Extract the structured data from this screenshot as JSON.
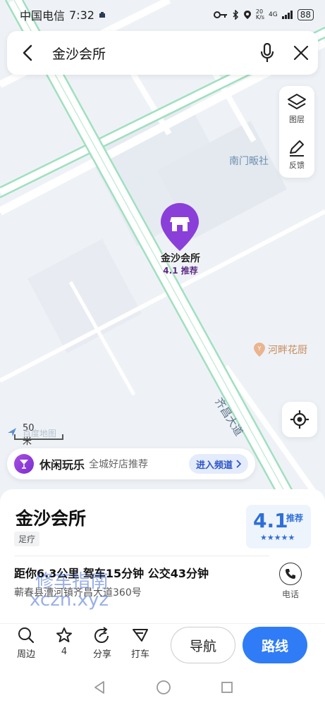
{
  "status_bar": {
    "carrier": "中国电信",
    "time": "7:32",
    "net_speed_top": "20",
    "net_speed_bottom": "K/s",
    "signal": "4G",
    "battery": "88"
  },
  "search": {
    "query": "金沙会所"
  },
  "map_tools": {
    "layers_label": "图层",
    "feedback_label": "反馈"
  },
  "map": {
    "poi_name": "金沙会所",
    "poi_rating": "4.1 推荐",
    "label_nanmen": "南门畈社",
    "label_hepan": "河畔花厨",
    "road_name": "齐昌大道",
    "scale": "50米",
    "map_brand": "百度地图"
  },
  "channel": {
    "title": "休闲玩乐",
    "subtitle": "全城好店推荐",
    "enter": "进入频道"
  },
  "detail": {
    "name": "金沙会所",
    "category": "足疗",
    "rating": "4.1",
    "rating_tag": "推荐",
    "stars": "★★★★★",
    "distance": "距你6.3公里  驾车15分钟  公交43分钟",
    "address": "蕲春县漕河镇齐昌大道360号",
    "phone_label": "电话"
  },
  "watermark": {
    "line1": "修车指南",
    "line2": "xczn.xyz"
  },
  "actions": {
    "nearby": "周边",
    "favorite": "4",
    "share": "分享",
    "taxi": "打车",
    "navigate": "导航",
    "route": "路线"
  },
  "colors": {
    "accent": "#2f7cf6",
    "poi_purple": "#8a3fd9",
    "road_green": "#9fe0bf"
  }
}
